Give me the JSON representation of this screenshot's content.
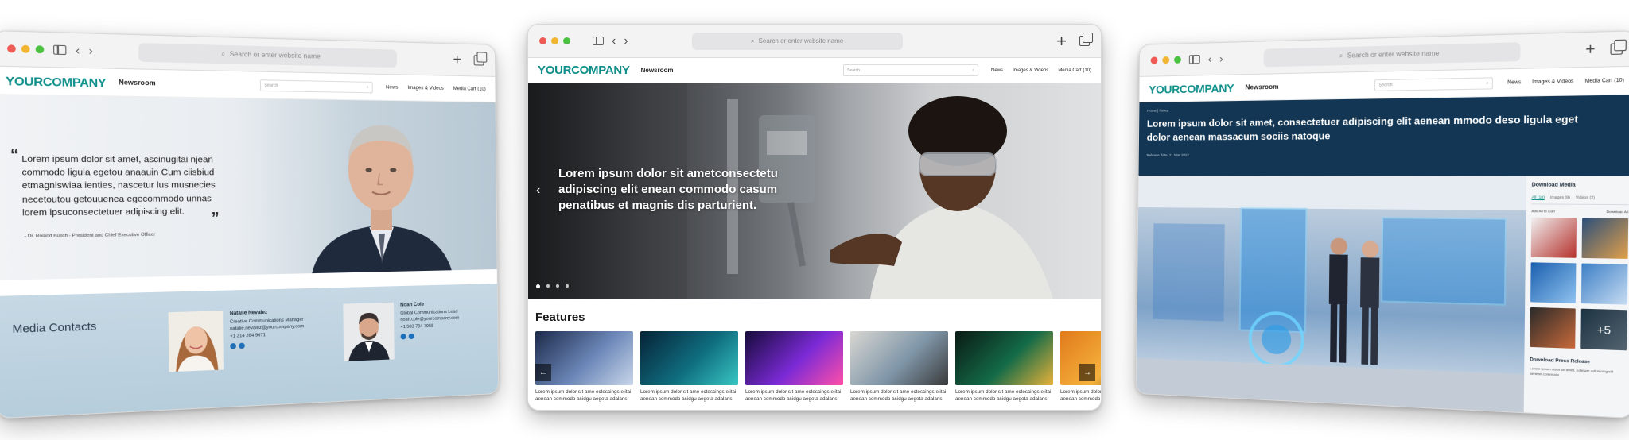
{
  "browser": {
    "url_placeholder": "Search or enter website name"
  },
  "site": {
    "logo": "YOURCOMPANY",
    "section": "Newsroom",
    "search_placeholder": "Search",
    "nav": [
      "News",
      "Images & Videos",
      "Media Cart (10)"
    ]
  },
  "left": {
    "quote": "Lorem ipsum dolor sit amet, ascinugitai njean commodo ligula egetou anaauin Cum ciisbiud etmagniswiaa ienties, nascetur lus musnecies necetoutou getouuenea egecommodo unnas lorem ipsuconsectetuer adipiscing elit.",
    "quote_open": "“",
    "quote_close": "”",
    "author": "- Dr. Roland Busch - President and Chief Executive Officer",
    "contacts_title": "Media Contacts",
    "contacts": [
      {
        "name": "Natalie Nevalez",
        "role": "Creative Communications Manager",
        "email": "natalie.nevalez@yourcompany.com",
        "phone": "+1 314 264 9671"
      },
      {
        "name": "Noah Cole",
        "role": "Global Communications Lead",
        "email": "noah.cole@yourcompany.com",
        "phone": "+1 503 784 7958"
      }
    ]
  },
  "middle": {
    "hero_text": "Lorem ipsum dolor sit ametconsectetu adipiscing elit enean commodo casum penatibus et magnis dis parturient.",
    "hero_prev": "‹",
    "features_title": "Features",
    "card_text": "Lorem ipsum dolor sit ame ectescings elitai aenean commodo asidgu aegeta adalaris sit ame nece",
    "cards": [
      {
        "colors": [
          "#1d2a4a",
          "#6b87b8",
          "#c9d6ea"
        ]
      },
      {
        "colors": [
          "#062236",
          "#0f6d7e",
          "#38c6c4"
        ]
      },
      {
        "colors": [
          "#160b3a",
          "#7b2ad6",
          "#ff4fa8"
        ]
      },
      {
        "colors": [
          "#d9d7d2",
          "#7f96a8",
          "#3a3a3a"
        ]
      },
      {
        "colors": [
          "#0a1a14",
          "#146b48",
          "#e9b23a"
        ]
      },
      {
        "colors": [
          "#e07a1c",
          "#f6b23c",
          "#3a1c08"
        ]
      }
    ],
    "carousel_prev": "←",
    "carousel_next": "→"
  },
  "right": {
    "breadcrumb": "Home  |  News",
    "title": "Lorem ipsum dolor sit amet, consectetuer adipiscing elit aenean mmodo deso ligula eget dolor aenean massacum sociis natoque",
    "date": "Release date: 21 Mar 2022",
    "download_title": "Download Media",
    "tabs": [
      "All (10)",
      "Images (8)",
      "Videos (2)"
    ],
    "add_all": "Add All to Cart",
    "download_all": "Download All",
    "more_count": "+5",
    "press_title": "Download Press Release",
    "press_text": "Lorem ipsum dolor sit amet, ectetuer adipiscing elit aenean commodo"
  }
}
